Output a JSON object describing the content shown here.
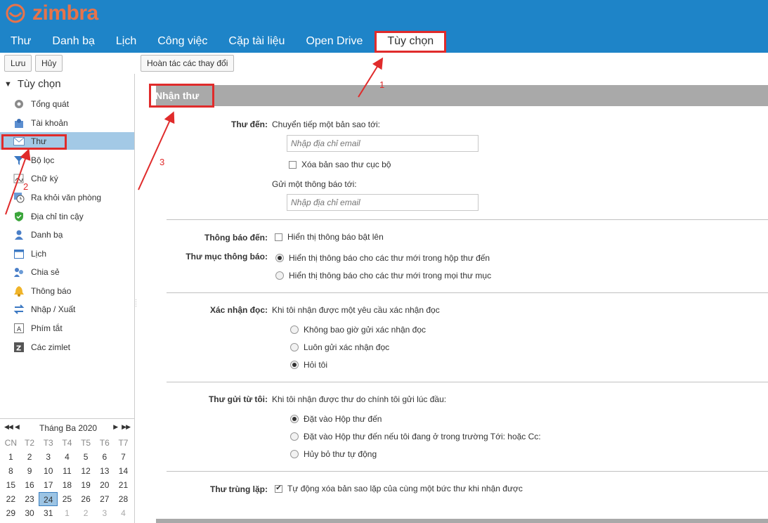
{
  "app": {
    "logo_text": "zimbra",
    "brand_color": "#1e84c8",
    "logo_color": "#e8734a"
  },
  "nav": {
    "tabs": [
      "Thư",
      "Danh bạ",
      "Lịch",
      "Công việc",
      "Cặp tài liệu",
      "Open Drive",
      "Tùy chọn"
    ],
    "active": "Tùy chọn"
  },
  "toolbar": {
    "save": "Lưu",
    "cancel": "Hủy",
    "revert": "Hoàn tác các thay đổi"
  },
  "sidebar": {
    "header": "Tùy chọn",
    "items": [
      {
        "label": "Tổng quát",
        "icon": "gear-icon"
      },
      {
        "label": "Tài khoản",
        "icon": "account-icon"
      },
      {
        "label": "Thư",
        "icon": "mail-icon"
      },
      {
        "label": "Bộ lọc",
        "icon": "filter-icon"
      },
      {
        "label": "Chữ ký",
        "icon": "signature-icon"
      },
      {
        "label": "Ra khỏi văn phòng",
        "icon": "out-of-office-icon"
      },
      {
        "label": "Địa chỉ tin cậy",
        "icon": "shield-icon"
      },
      {
        "label": "Danh bạ",
        "icon": "contact-icon"
      },
      {
        "label": "Lịch",
        "icon": "calendar-icon"
      },
      {
        "label": "Chia sẻ",
        "icon": "share-icon"
      },
      {
        "label": "Thông báo",
        "icon": "bell-icon"
      },
      {
        "label": "Nhập / Xuất",
        "icon": "import-export-icon"
      },
      {
        "label": "Phím tắt",
        "icon": "shortcut-icon"
      },
      {
        "label": "Các zimlet",
        "icon": "zimlet-icon"
      }
    ],
    "selected": "Thư"
  },
  "calendar": {
    "title": "Tháng Ba 2020",
    "dow": [
      "CN",
      "T2",
      "T3",
      "T4",
      "T5",
      "T6",
      "T7"
    ],
    "days": [
      "1",
      "2",
      "3",
      "4",
      "5",
      "6",
      "7",
      "8",
      "9",
      "10",
      "11",
      "12",
      "13",
      "14",
      "15",
      "16",
      "17",
      "18",
      "19",
      "20",
      "21",
      "22",
      "23",
      "24",
      "25",
      "26",
      "27",
      "28",
      "29",
      "30",
      "31",
      "1",
      "2",
      "3",
      "4"
    ],
    "today": "24"
  },
  "section": {
    "title": "Nhận thư",
    "forward_label": "Thư đến:",
    "forward_text": "Chuyển tiếp một bản sao tới:",
    "email_placeholder": "Nhập địa chỉ email",
    "delete_local": "Xóa bản sao thư cục bộ",
    "notify_to": "Gửi một thông báo tới:",
    "notify_label": "Thông báo đến:",
    "popup_text": "Hiển thị thông báo bật lên",
    "folder_notify_label": "Thư mục thông báo:",
    "folder_inbox": "Hiển thị thông báo cho các thư mới trong hộp thư đến",
    "folder_all": "Hiển thị thông báo cho các thư mới trong mọi thư mục",
    "read_receipt_label": "Xác nhận đọc:",
    "read_receipt_text": "Khi tôi nhận được một yêu cầu xác nhận đọc",
    "rr_never": "Không bao giờ gửi xác nhận đọc",
    "rr_always": "Luôn gửi xác nhận đọc",
    "rr_ask": "Hỏi tôi",
    "from_me_label": "Thư gửi từ tôi:",
    "from_me_text": "Khi tôi nhận được thư do chính tôi gửi lúc đầu:",
    "fm_inbox": "Đặt vào Hộp thư đến",
    "fm_inbox_if": "Đặt vào Hộp thư đến nếu tôi đang ở trong trường Tới: hoặc Cc:",
    "fm_delete": "Hủy bỏ thư tự động",
    "dup_label": "Thư trùng lặp:",
    "dup_text": "Tự động xóa bản sao lặp của cùng một bức thư khi nhận được"
  },
  "annotations": {
    "a1": "1",
    "a2": "2",
    "a3": "3",
    "color": "#e02b2b"
  }
}
